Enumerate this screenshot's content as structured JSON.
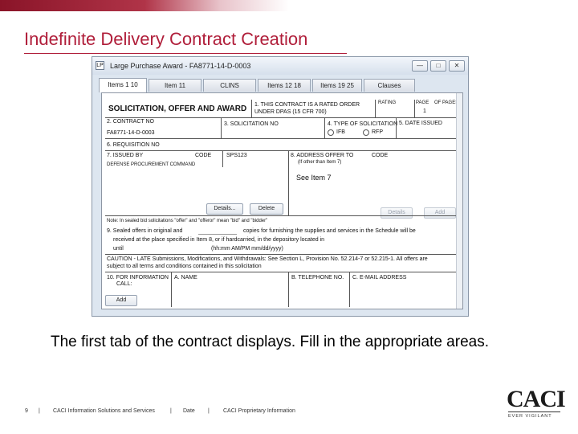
{
  "slide": {
    "title": "Indefinite Delivery Contract Creation",
    "caption": "The first tab of the contract displays.  Fill in the appropriate areas."
  },
  "window": {
    "title": "Large Purchase Award - FA8771-14-D-0003",
    "icon_text": "LP",
    "buttons": [
      "minimize-icon",
      "maximize-icon",
      "close-icon"
    ]
  },
  "tabs": [
    {
      "label": "Items 1 10",
      "active": true
    },
    {
      "label": "Item 11"
    },
    {
      "label": "CLINS"
    },
    {
      "label": "Items 12 18"
    },
    {
      "label": "Items 19 25"
    },
    {
      "label": "Clauses"
    }
  ],
  "form": {
    "heading": "SOLICITATION, OFFER AND AWARD",
    "rated_order": "1. THIS CONTRACT IS A RATED ORDER UNDER DPAS (15 CFR 700)",
    "rating_label": "RATING",
    "page_label": "PAGE",
    "of_pages_label": "OF PAGES",
    "page_value": "1",
    "contract_no_label": "2. CONTRACT NO",
    "contract_no_value": "FA8771-14-D-0003",
    "solicitation_no_label": "3. SOLICITATION NO",
    "type_label": "4. TYPE OF SOLICITATION",
    "type_options": [
      "IFB",
      "RFP"
    ],
    "date_issued_label": "5. DATE ISSUED",
    "requisition_label": "6. REQUISITION NO",
    "issued_by_label": "7. ISSUED BY",
    "code_label": "CODE",
    "code_value": "SPS123",
    "issued_by_value": "DEFENSE PROCUREMENT COMMAND",
    "address_label": "8. ADDRESS OFFER TO",
    "address_code_label": "CODE",
    "address_note": "(If other than Item 7)",
    "see_item": "See Item 7",
    "details_label": "Details...",
    "delete_label": "Delete",
    "details_right_label": "Details",
    "add_right_label": "Add",
    "note": "Note: In sealed bid solicitations \"offer\" and \"offeror\" mean \"bid\" and \"bidder\"",
    "sealed_a": "9. Sealed offers in original and",
    "sealed_b": "copies for furnishing the supplies and services in the Schedule will be",
    "sealed_c": "received at the place specified in Item 8, or if hardcarried, in the depository located in",
    "until": "until",
    "time_format": "(hh:mm AM/PM mm/dd/yyyy)",
    "caution_1": "CAUTION - LATE Submissions, Modifications, and Withdrawals:  See Section L, Provision No. 52.214-7 or 52.215-1.  All offers are",
    "caution_2": "subject to all terms and conditions contained in this solicitation",
    "info_label": "10. FOR INFORMATION",
    "call_label": "CALL:",
    "name_label": "A. NAME",
    "phone_label": "B. TELEPHONE NO.",
    "email_label": "C. E-MAIL ADDRESS",
    "add_bottom_label": "Add"
  },
  "footer": {
    "page_number": "9",
    "sep": "|",
    "company": "CACI Information Solutions and Services",
    "date": "Date",
    "proprietary": "CACI Proprietary Information"
  },
  "logo": {
    "text": "CACI",
    "tagline": "EVER VIGILANT"
  }
}
